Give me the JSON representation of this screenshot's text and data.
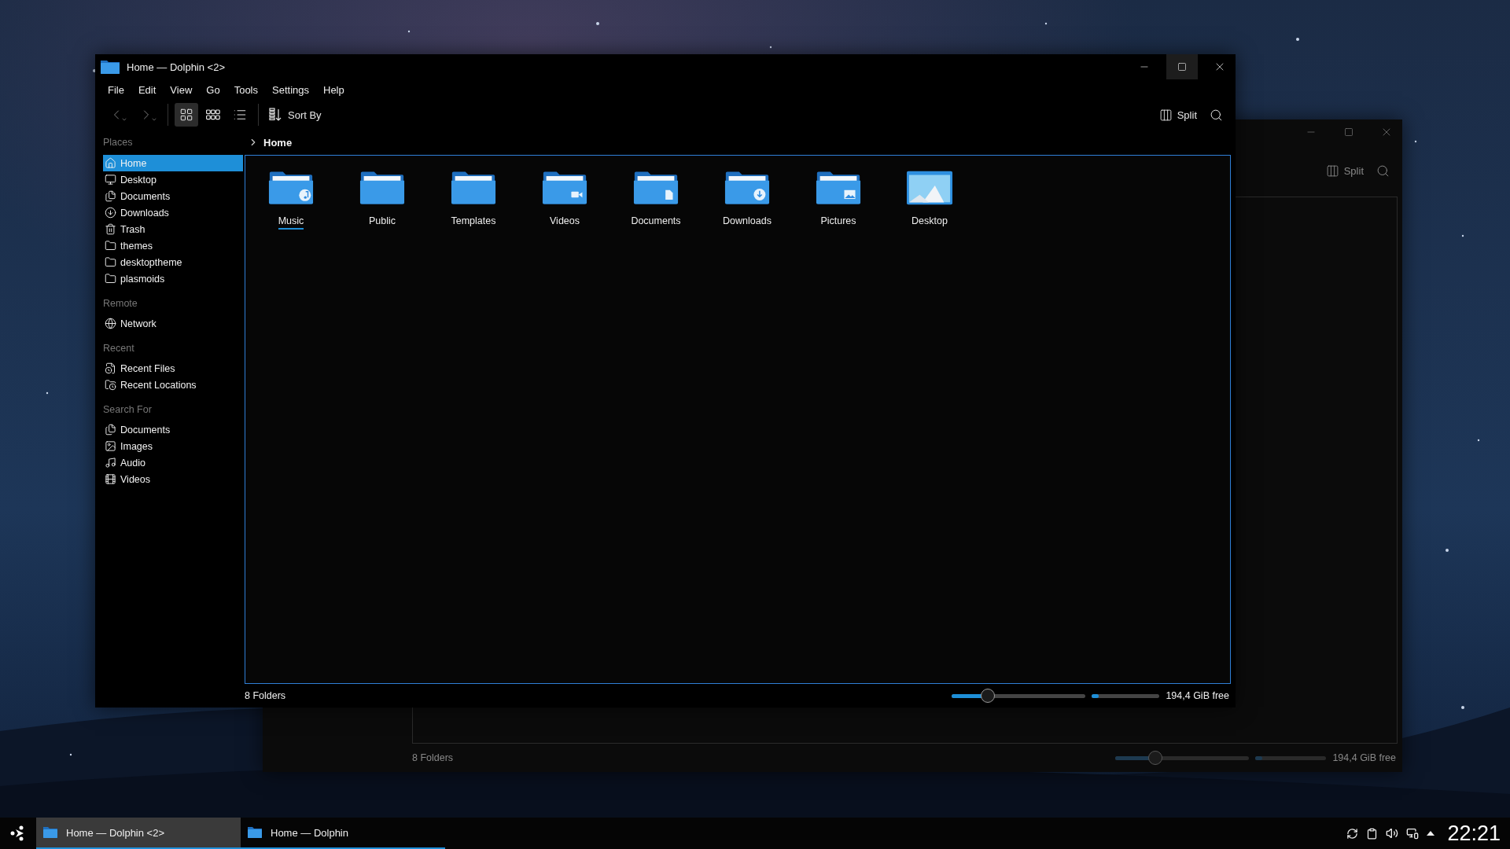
{
  "back_window": {
    "split_label": "Split",
    "status": {
      "summary": "8 Folders",
      "zoom": {
        "level": 0.3
      },
      "capacity": {
        "level": 0.1
      },
      "free": "194,4 GiB free"
    }
  },
  "window": {
    "title": "Home — Dolphin <2>",
    "menu": [
      "File",
      "Edit",
      "View",
      "Go",
      "Tools",
      "Settings",
      "Help"
    ],
    "view_modes": [
      {
        "kind": "icons",
        "selected": true
      },
      {
        "kind": "compact",
        "selected": false
      },
      {
        "kind": "details",
        "selected": false
      }
    ],
    "sort_label": "Sort By",
    "split_label": "Split",
    "breadcrumb": "Home",
    "sidebar": [
      {
        "title": "Places",
        "items": [
          {
            "label": "Home",
            "kind": "home",
            "selected": true
          },
          {
            "label": "Desktop",
            "kind": "desktop",
            "selected": false
          },
          {
            "label": "Documents",
            "kind": "documents",
            "selected": false
          },
          {
            "label": "Downloads",
            "kind": "downloads",
            "selected": false
          },
          {
            "label": "Trash",
            "kind": "trash",
            "selected": false
          },
          {
            "label": "themes",
            "kind": "folder",
            "selected": false
          },
          {
            "label": "desktoptheme",
            "kind": "folder",
            "selected": false
          },
          {
            "label": "plasmoids",
            "kind": "folder",
            "selected": false
          }
        ]
      },
      {
        "title": "Remote",
        "items": [
          {
            "label": "Network",
            "kind": "network",
            "selected": false
          }
        ]
      },
      {
        "title": "Recent",
        "items": [
          {
            "label": "Recent Files",
            "kind": "recent-files",
            "selected": false
          },
          {
            "label": "Recent Locations",
            "kind": "recent-locations",
            "selected": false
          }
        ]
      },
      {
        "title": "Search For",
        "items": [
          {
            "label": "Documents",
            "kind": "documents",
            "selected": false
          },
          {
            "label": "Images",
            "kind": "images",
            "selected": false
          },
          {
            "label": "Audio",
            "kind": "audio",
            "selected": false
          },
          {
            "label": "Videos",
            "kind": "videos",
            "selected": false
          }
        ]
      }
    ],
    "folders": [
      {
        "name": "Music",
        "kind": "music",
        "focused": true
      },
      {
        "name": "Public",
        "kind": "plain",
        "focused": false
      },
      {
        "name": "Templates",
        "kind": "plain",
        "focused": false
      },
      {
        "name": "Videos",
        "kind": "videos",
        "focused": false
      },
      {
        "name": "Documents",
        "kind": "documents",
        "focused": false
      },
      {
        "name": "Downloads",
        "kind": "downloads",
        "focused": false
      },
      {
        "name": "Pictures",
        "kind": "pictures",
        "focused": false
      },
      {
        "name": "Desktop",
        "kind": "desktop",
        "focused": false
      }
    ],
    "status": {
      "summary": "8 Folders",
      "zoom": {
        "level": 0.27
      },
      "capacity": {
        "level": 0.1
      },
      "free": "194,4 GiB free"
    }
  },
  "taskbar": {
    "tasks": [
      {
        "label": "Home — Dolphin <2>",
        "selected": true
      },
      {
        "label": "Home — Dolphin",
        "selected": false
      }
    ],
    "clock": "22:21"
  }
}
